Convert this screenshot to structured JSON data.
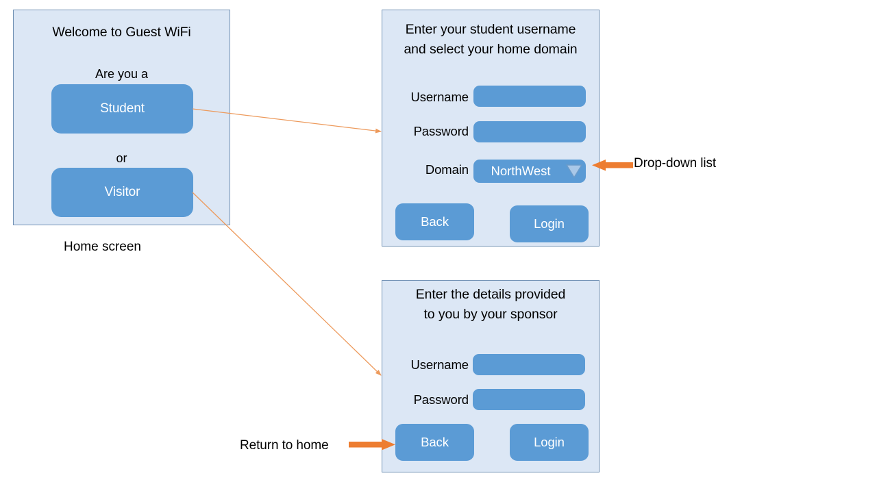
{
  "diagram": {
    "caption_home": "Home screen"
  },
  "panels": {
    "home": {
      "heading": "Welcome to Guest WiFi",
      "prompt": "Are you a",
      "student_button": "Student",
      "or_text": "or",
      "visitor_button": "Visitor"
    },
    "student": {
      "heading_line1": "Enter your student username",
      "heading_line2": "and select your home domain",
      "username_label": "Username",
      "username_value": "",
      "password_label": "Password",
      "password_value": "",
      "domain_label": "Domain",
      "domain_value": "NorthWest",
      "domain_caret_icon": "chevron-down-icon",
      "back_button": "Back",
      "login_button": "Login"
    },
    "visitor": {
      "heading_line1": "Enter the details provided",
      "heading_line2": "to you by your sponsor",
      "username_label": "Username",
      "username_value": "",
      "password_label": "Password",
      "password_value": "",
      "back_button": "Back",
      "login_button": "Login"
    }
  },
  "annotations": {
    "dropdown_note": "Drop-down list",
    "return_home_note": "Return to home"
  },
  "colors": {
    "panel_fill": "#DCE7F5",
    "panel_border": "#7191B4",
    "control_blue": "#5B9BD5",
    "caret_fill": "#A9C8E8",
    "annotation_orange": "#ED7D31",
    "connector_orange": "#ED9A5C",
    "text_black": "#000000",
    "control_text": "#FFFFFF"
  }
}
